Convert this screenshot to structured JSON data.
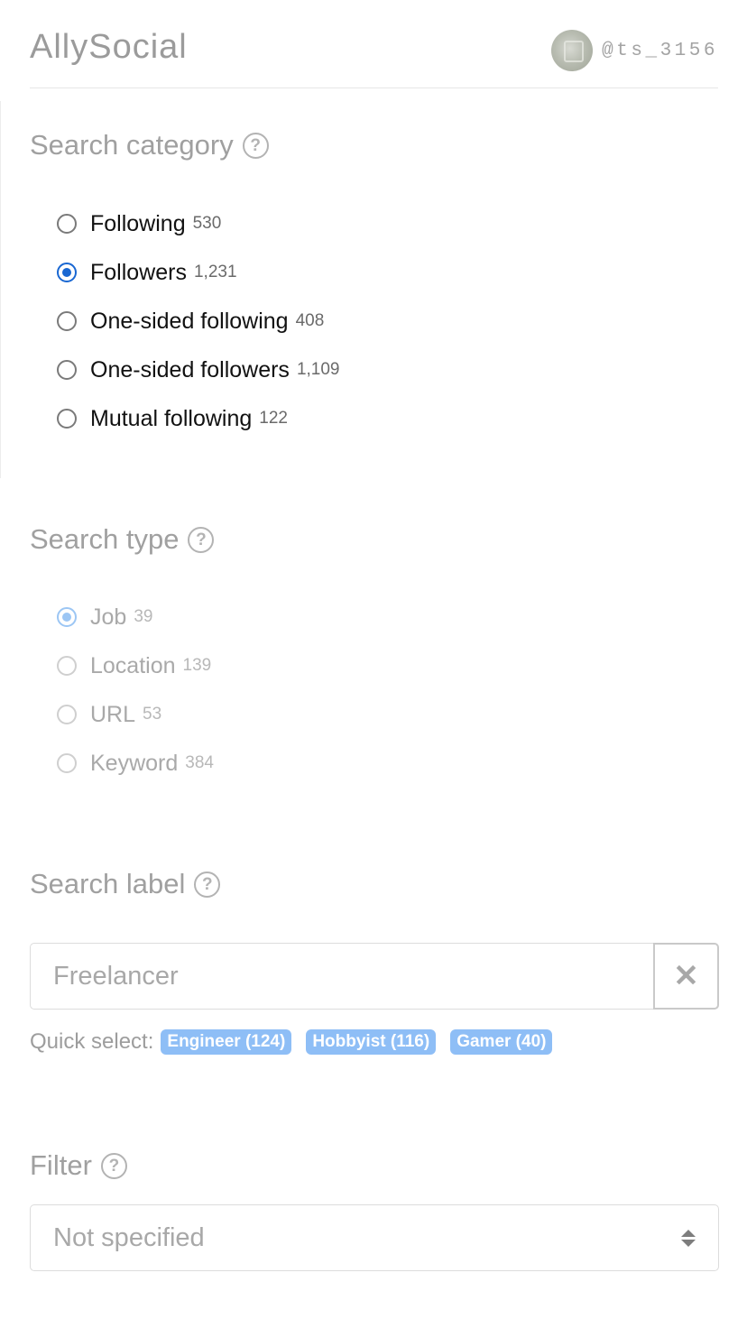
{
  "header": {
    "app_title": "AllySocial",
    "username": "@ts_3156"
  },
  "search_category": {
    "title": "Search category",
    "help": "?",
    "options": [
      {
        "label": "Following",
        "count": "530",
        "checked": false
      },
      {
        "label": "Followers",
        "count": "1,231",
        "checked": true
      },
      {
        "label": "One-sided following",
        "count": "408",
        "checked": false
      },
      {
        "label": "One-sided followers",
        "count": "1,109",
        "checked": false
      },
      {
        "label": "Mutual following",
        "count": "122",
        "checked": false
      }
    ]
  },
  "search_type": {
    "title": "Search type",
    "help": "?",
    "options": [
      {
        "label": "Job",
        "count": "39",
        "checked": true
      },
      {
        "label": "Location",
        "count": "139",
        "checked": false
      },
      {
        "label": "URL",
        "count": "53",
        "checked": false
      },
      {
        "label": "Keyword",
        "count": "384",
        "checked": false
      }
    ]
  },
  "search_label": {
    "title": "Search label",
    "help": "?",
    "placeholder": "Freelancer",
    "value": "",
    "clear_icon": "✕",
    "quick_select_label": "Quick select:",
    "chips": [
      "Engineer (124)",
      "Hobbyist (116)",
      "Gamer (40)"
    ]
  },
  "filter": {
    "title": "Filter",
    "help": "?",
    "selected": "Not specified"
  },
  "colors": {
    "accent": "#1967d2",
    "chip": "#8ebef6",
    "muted_text": "#a0a0a0"
  }
}
